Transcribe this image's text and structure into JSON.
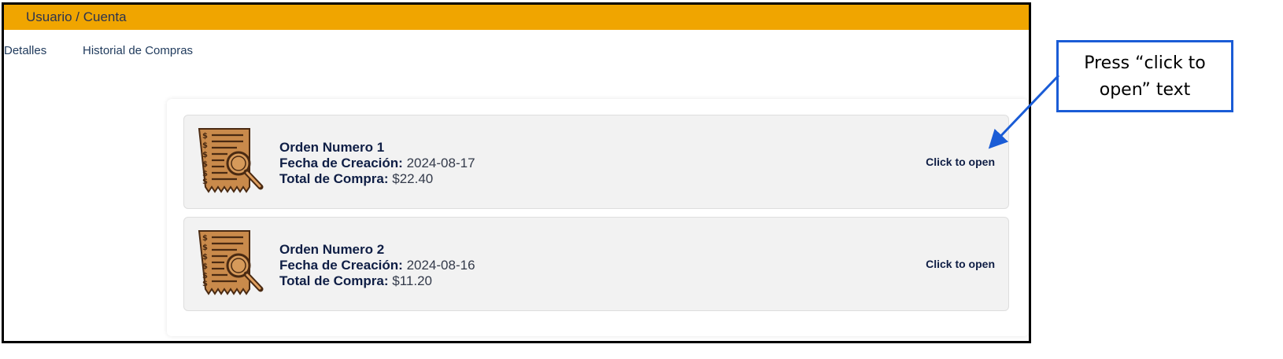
{
  "header": {
    "title": "Usuario / Cuenta"
  },
  "tabs": [
    {
      "label": "Detalles"
    },
    {
      "label": "Historial de Compras"
    }
  ],
  "orders": [
    {
      "title": "Orden Numero 1",
      "date_label": "Fecha de Creación:",
      "date_value": "2024-08-17",
      "total_label": "Total de Compra:",
      "total_value": "$22.40",
      "action_label": "Click to open"
    },
    {
      "title": "Orden Numero 2",
      "date_label": "Fecha de Creación:",
      "date_value": "2024-08-16",
      "total_label": "Total de Compra:",
      "total_value": "$11.20",
      "action_label": "Click to open"
    }
  ],
  "annotation": {
    "text": "Press “click to open” text"
  },
  "colors": {
    "header_bar": "#f0a500",
    "annotation_blue": "#1a5cd6",
    "receipt_paper": "#c98a4b",
    "text_navy": "#0f1e45"
  }
}
